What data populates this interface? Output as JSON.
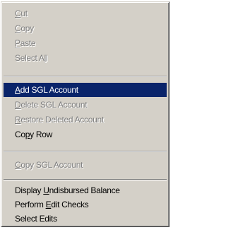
{
  "menu": {
    "items": [
      {
        "pre": "",
        "mn": "C",
        "post": "ut"
      },
      {
        "pre": "",
        "mn": "C",
        "post": "opy"
      },
      {
        "pre": "",
        "mn": "P",
        "post": "aste"
      },
      {
        "pre": "Select A",
        "mn": "l",
        "post": "l"
      },
      {
        "pre": "",
        "mn": "A",
        "post": "dd SGL Account"
      },
      {
        "pre": "",
        "mn": "D",
        "post": "elete SGL Account"
      },
      {
        "pre": "",
        "mn": "R",
        "post": "estore Deleted Account"
      },
      {
        "pre": "Co",
        "mn": "p",
        "post": "y Row"
      },
      {
        "pre": "",
        "mn": "C",
        "post": "opy SGL Account"
      },
      {
        "pre": "Display ",
        "mn": "U",
        "post": "ndisbursed Balance"
      },
      {
        "pre": "Perform ",
        "mn": "E",
        "post": "dit Checks"
      },
      {
        "pre": "Select Edits",
        "mn": "",
        "post": ""
      }
    ]
  }
}
